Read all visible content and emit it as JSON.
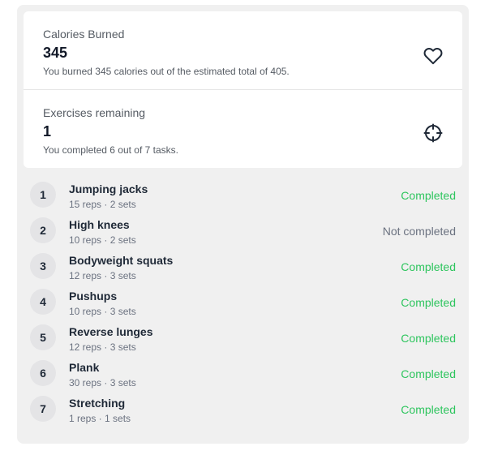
{
  "stats": {
    "calories": {
      "label": "Calories Burned",
      "value": "345",
      "description": "You burned 345 calories out of the estimated total of 405.",
      "icon": "heart-icon"
    },
    "exercises_remaining": {
      "label": "Exercises remaining",
      "value": "1",
      "description": "You completed 6 out of 7 tasks.",
      "icon": "crosshair-icon"
    }
  },
  "colors": {
    "completed": "#2ec55e",
    "not_completed": "#6b7280",
    "panel_bg": "#f0f0f0"
  },
  "exercises": [
    {
      "number": "1",
      "name": "Jumping jacks",
      "detail": "15 reps · 2 sets",
      "status": "Completed",
      "completed": true
    },
    {
      "number": "2",
      "name": "High knees",
      "detail": "10 reps · 2 sets",
      "status": "Not completed",
      "completed": false
    },
    {
      "number": "3",
      "name": "Bodyweight squats",
      "detail": "12 reps · 3 sets",
      "status": "Completed",
      "completed": true
    },
    {
      "number": "4",
      "name": "Pushups",
      "detail": "10 reps · 3 sets",
      "status": "Completed",
      "completed": true
    },
    {
      "number": "5",
      "name": "Reverse lunges",
      "detail": "12 reps · 3 sets",
      "status": "Completed",
      "completed": true
    },
    {
      "number": "6",
      "name": "Plank",
      "detail": "30 reps · 3 sets",
      "status": "Completed",
      "completed": true
    },
    {
      "number": "7",
      "name": "Stretching",
      "detail": "1 reps · 1 sets",
      "status": "Completed",
      "completed": true
    }
  ]
}
